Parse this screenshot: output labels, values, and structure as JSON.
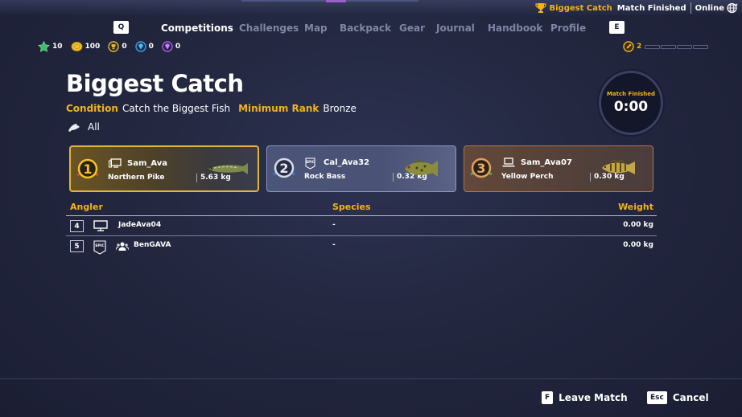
{
  "status": {
    "mode": "Biggest Catch",
    "state": "Match Finished",
    "connection": "Online",
    "icons": [
      "trophy-icon",
      "globe-icon"
    ]
  },
  "nav": {
    "left_key": "Q",
    "right_key": "E",
    "tabs": [
      {
        "label": "Competitions",
        "active": true
      },
      {
        "label": "Challenges"
      },
      {
        "label": "Map"
      },
      {
        "label": "Backpack"
      },
      {
        "label": "Gear"
      },
      {
        "label": "Journal"
      },
      {
        "label": "Handbook"
      },
      {
        "label": "Profile"
      }
    ]
  },
  "currencies": [
    {
      "icon": "star-icon",
      "value": "10"
    },
    {
      "icon": "coin-icon",
      "value": "100"
    },
    {
      "icon": "gold-trophy-token-icon",
      "value": "0"
    },
    {
      "icon": "blue-gem-icon",
      "value": "0"
    },
    {
      "icon": "purple-gem-icon",
      "value": "0"
    }
  ],
  "xp": {
    "icon": "pencil-badge-icon",
    "value": "2"
  },
  "competition": {
    "title": "Biggest Catch",
    "condition_label": "Condition",
    "condition_value": "Catch the Biggest Fish",
    "rank_label": "Minimum Rank",
    "rank_value": "Bronze",
    "filter": "All"
  },
  "timer": {
    "label": "Match Finished",
    "value": "0:00"
  },
  "podium": [
    {
      "rank": "1",
      "player": "Sam_Ava",
      "platform": "pc-icon",
      "species": "Northern Pike",
      "weight": "5.63 kg"
    },
    {
      "rank": "2",
      "player": "Cal_Ava32",
      "platform": "epic-icon",
      "species": "Rock Bass",
      "weight": "0.32 kg"
    },
    {
      "rank": "3",
      "player": "Sam_Ava07",
      "platform": "laptop-icon",
      "species": "Yellow Perch",
      "weight": "0.30 kg"
    }
  ],
  "table": {
    "headers": {
      "angler": "Angler",
      "species": "Species",
      "weight": "Weight"
    },
    "rows": [
      {
        "rank": "4",
        "angler": "JadeAva04",
        "platform": "pc-icon",
        "species": "-",
        "weight": "0.00 kg"
      },
      {
        "rank": "5",
        "angler": "BenGAVA",
        "platform": "epic-icon",
        "species": "-",
        "weight": "0.00 kg"
      }
    ]
  },
  "epic_logo_text": "EPIC",
  "footer": {
    "leave_key": "F",
    "leave_label": "Leave Match",
    "cancel_key": "Esc",
    "cancel_label": "Cancel"
  },
  "colors": {
    "accent": "#f2b418",
    "background": "#23273f",
    "gold": "#e1b43a",
    "silver": "#8a97bf",
    "bronze": "#b0754e"
  }
}
